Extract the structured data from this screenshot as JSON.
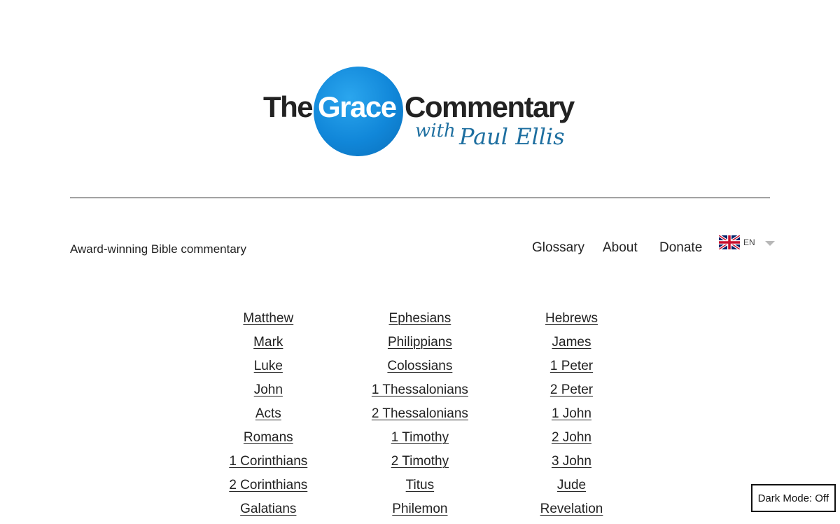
{
  "logo": {
    "word_the": "The",
    "word_grace": "Grace",
    "word_commentary": "Commentary",
    "word_with": "with",
    "author": "Paul Ellis",
    "accent_color": "#1187d9"
  },
  "header": {
    "tagline": "Award-winning Bible commentary"
  },
  "nav": {
    "items": [
      {
        "label": "Glossary"
      },
      {
        "label": "About"
      },
      {
        "label": "Donate"
      }
    ],
    "language": {
      "code": "EN",
      "flag_icon": "uk-flag-icon"
    }
  },
  "books": {
    "columns": [
      [
        "Matthew",
        "Mark",
        "Luke",
        "John",
        "Acts",
        "Romans",
        "1 Corinthians",
        "2 Corinthians",
        "Galatians"
      ],
      [
        "Ephesians",
        "Philippians",
        "Colossians",
        "1 Thessalonians",
        "2 Thessalonians",
        "1 Timothy",
        "2 Timothy",
        "Titus",
        "Philemon"
      ],
      [
        "Hebrews",
        "James",
        "1 Peter",
        "2 Peter",
        "1 John",
        "2 John",
        "3 John",
        "Jude",
        "Revelation"
      ]
    ]
  },
  "dark_mode": {
    "label": "Dark Mode: Off"
  }
}
